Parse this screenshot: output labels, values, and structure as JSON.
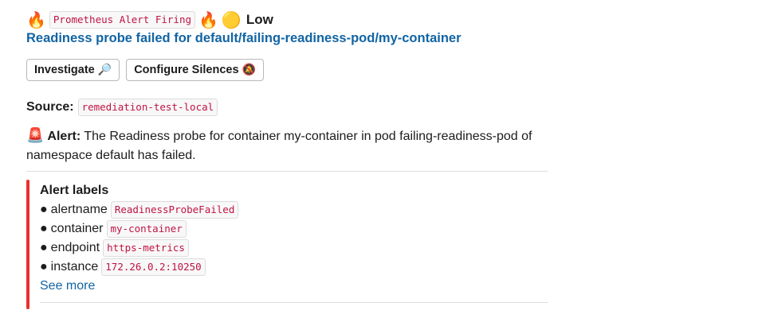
{
  "header": {
    "fire_icon": "fire-icon",
    "badge": "Prometheus Alert Firing",
    "severity_icon": "yellow-circle-icon",
    "severity": "Low"
  },
  "title": "Readiness probe failed for default/failing-readiness-pod/my-container",
  "buttons": {
    "investigate": "Investigate",
    "investigate_icon": "🔎",
    "silences": "Configure Silences",
    "silences_icon": "🔕"
  },
  "source": {
    "label": "Source:",
    "value": "remediation-test-local"
  },
  "alert": {
    "icon": "🚨",
    "label": "Alert:",
    "text": "The Readiness probe for container my-container in pod failing-readiness-pod of namespace default has failed."
  },
  "labels": {
    "heading": "Alert labels",
    "items": [
      {
        "key": "alertname",
        "value": "ReadinessProbeFailed"
      },
      {
        "key": "container",
        "value": "my-container"
      },
      {
        "key": "endpoint",
        "value": "https-metrics"
      },
      {
        "key": "instance",
        "value": "172.26.0.2:10250"
      }
    ],
    "see_more": "See more"
  },
  "colors": {
    "link": "#1264a3",
    "code_text": "#c01343",
    "accent_bar": "#e8312f"
  }
}
